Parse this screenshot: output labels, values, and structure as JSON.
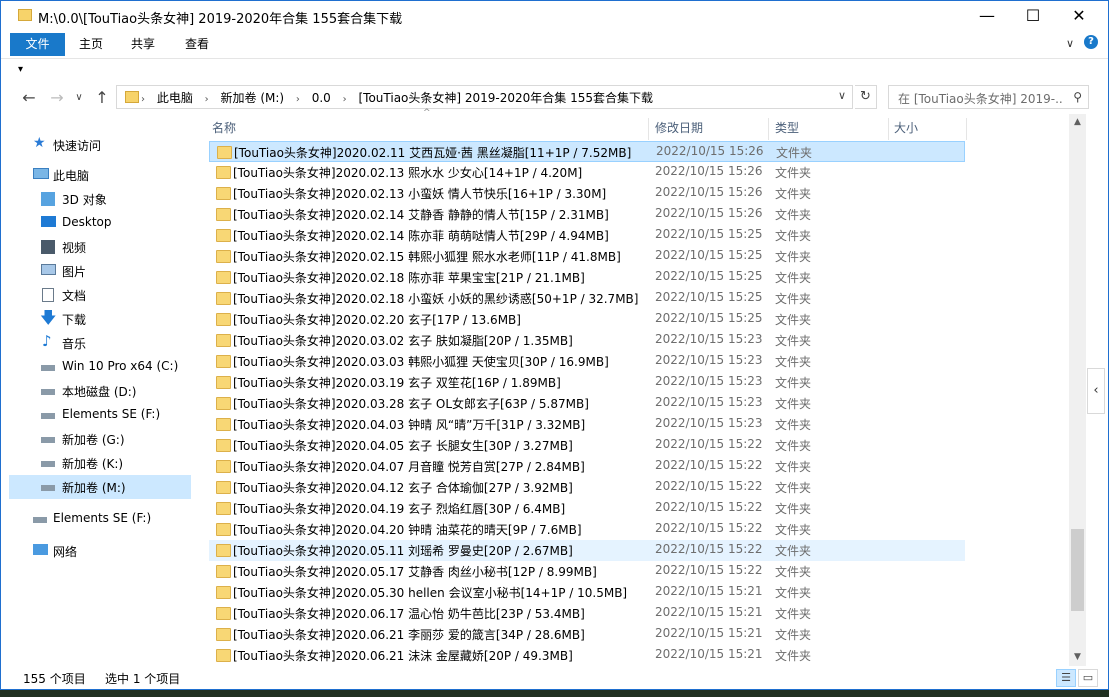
{
  "window": {
    "title": "M:\\0.0\\[TouTiao头条女神] 2019-2020年合集 155套合集下载",
    "minimize": "—",
    "maximize": "☐",
    "close": "✕"
  },
  "ribbon": {
    "tabs": [
      "文件",
      "主页",
      "共享",
      "查看"
    ],
    "expand": "∨",
    "help": "?"
  },
  "qat": {
    "arrow": "▾"
  },
  "nav": {
    "back": "←",
    "forward": "→",
    "recent": "∨",
    "up": "↑",
    "breadcrumb": [
      "此电脑",
      "新加卷 (M:)",
      "0.0",
      "[TouTiao头条女神] 2019-2020年合集 155套合集下载"
    ],
    "crumb_sep": "›",
    "address_dropdown": "∨",
    "refresh": "↻",
    "search_placeholder": "在 [TouTiao头条女神] 2019-...",
    "search_icon": "⚲"
  },
  "sidebar": {
    "items": [
      {
        "label": "快速访问",
        "icon": "star-icon"
      },
      {
        "label": "此电脑",
        "icon": "computer-icon"
      },
      {
        "label": "3D 对象",
        "icon": "cube-icon"
      },
      {
        "label": "Desktop",
        "icon": "desktop-icon"
      },
      {
        "label": "视频",
        "icon": "video-icon"
      },
      {
        "label": "图片",
        "icon": "picture-icon"
      },
      {
        "label": "文档",
        "icon": "document-icon"
      },
      {
        "label": "下载",
        "icon": "download-icon"
      },
      {
        "label": "音乐",
        "icon": "music-icon"
      },
      {
        "label": "Win 10 Pro x64 (C:)",
        "icon": "windows-drive-icon"
      },
      {
        "label": "本地磁盘 (D:)",
        "icon": "drive-icon"
      },
      {
        "label": "Elements SE (F:)",
        "icon": "drive-icon"
      },
      {
        "label": "新加卷 (G:)",
        "icon": "drive-icon"
      },
      {
        "label": "新加卷 (K:)",
        "icon": "drive-icon"
      },
      {
        "label": "新加卷 (M:)",
        "icon": "drive-icon"
      },
      {
        "label": "Elements SE (F:)",
        "icon": "drive-icon"
      },
      {
        "label": "网络",
        "icon": "network-icon"
      }
    ]
  },
  "columns": {
    "name": "名称",
    "date": "修改日期",
    "type": "类型",
    "size": "大小",
    "sort_indicator": "^"
  },
  "files": [
    {
      "name": "[TouTiao头条女神]2020.02.11 艾西瓦娅·茜 黑丝凝脂[11+1P / 7.52MB]",
      "date": "2022/10/15 15:26",
      "type": "文件夹"
    },
    {
      "name": "[TouTiao头条女神]2020.02.13 熙水水 少女心[14+1P / 4.20M]",
      "date": "2022/10/15 15:26",
      "type": "文件夹"
    },
    {
      "name": "[TouTiao头条女神]2020.02.13 小蛮妖 情人节快乐[16+1P / 3.30M]",
      "date": "2022/10/15 15:26",
      "type": "文件夹"
    },
    {
      "name": "[TouTiao头条女神]2020.02.14 艾静香 静静的情人节[15P / 2.31MB]",
      "date": "2022/10/15 15:26",
      "type": "文件夹"
    },
    {
      "name": "[TouTiao头条女神]2020.02.14 陈亦菲 萌萌哒情人节[29P / 4.94MB]",
      "date": "2022/10/15 15:25",
      "type": "文件夹"
    },
    {
      "name": "[TouTiao头条女神]2020.02.15 韩熙小狐狸 熙水水老师[11P / 41.8MB]",
      "date": "2022/10/15 15:25",
      "type": "文件夹"
    },
    {
      "name": "[TouTiao头条女神]2020.02.18 陈亦菲 苹果宝宝[21P / 21.1MB]",
      "date": "2022/10/15 15:25",
      "type": "文件夹"
    },
    {
      "name": "[TouTiao头条女神]2020.02.18 小蛮妖 小妖的黑纱诱惑[50+1P / 32.7MB]",
      "date": "2022/10/15 15:25",
      "type": "文件夹"
    },
    {
      "name": "[TouTiao头条女神]2020.02.20 玄子[17P / 13.6MB]",
      "date": "2022/10/15 15:25",
      "type": "文件夹"
    },
    {
      "name": "[TouTiao头条女神]2020.03.02 玄子 肤如凝脂[20P / 1.35MB]",
      "date": "2022/10/15 15:23",
      "type": "文件夹"
    },
    {
      "name": "[TouTiao头条女神]2020.03.03 韩熙小狐狸 天使宝贝[30P / 16.9MB]",
      "date": "2022/10/15 15:23",
      "type": "文件夹"
    },
    {
      "name": "[TouTiao头条女神]2020.03.19 玄子 双笙花[16P / 1.89MB]",
      "date": "2022/10/15 15:23",
      "type": "文件夹"
    },
    {
      "name": "[TouTiao头条女神]2020.03.28 玄子 OL女郎玄子[63P / 5.87MB]",
      "date": "2022/10/15 15:23",
      "type": "文件夹"
    },
    {
      "name": "[TouTiao头条女神]2020.04.03 钟晴 风“晴”万千[31P / 3.32MB]",
      "date": "2022/10/15 15:23",
      "type": "文件夹"
    },
    {
      "name": "[TouTiao头条女神]2020.04.05 玄子 长腿女生[30P / 3.27MB]",
      "date": "2022/10/15 15:22",
      "type": "文件夹"
    },
    {
      "name": "[TouTiao头条女神]2020.04.07 月音瞳 悦芳自赏[27P / 2.84MB]",
      "date": "2022/10/15 15:22",
      "type": "文件夹"
    },
    {
      "name": "[TouTiao头条女神]2020.04.12 玄子 合体瑜伽[27P / 3.92MB]",
      "date": "2022/10/15 15:22",
      "type": "文件夹"
    },
    {
      "name": "[TouTiao头条女神]2020.04.19 玄子 烈焰红唇[30P / 6.4MB]",
      "date": "2022/10/15 15:22",
      "type": "文件夹"
    },
    {
      "name": "[TouTiao头条女神]2020.04.20 钟晴 油菜花的晴天[9P / 7.6MB]",
      "date": "2022/10/15 15:22",
      "type": "文件夹"
    },
    {
      "name": "[TouTiao头条女神]2020.05.11 刘瑶希 罗曼史[20P / 2.67MB]",
      "date": "2022/10/15 15:22",
      "type": "文件夹"
    },
    {
      "name": "[TouTiao头条女神]2020.05.17 艾静香 肉丝小秘书[12P / 8.99MB]",
      "date": "2022/10/15 15:22",
      "type": "文件夹"
    },
    {
      "name": "[TouTiao头条女神]2020.05.30 hellen 会议室小秘书[14+1P / 10.5MB]",
      "date": "2022/10/15 15:21",
      "type": "文件夹"
    },
    {
      "name": "[TouTiao头条女神]2020.06.17 温心怡 奶牛芭比[23P / 53.4MB]",
      "date": "2022/10/15 15:21",
      "type": "文件夹"
    },
    {
      "name": "[TouTiao头条女神]2020.06.21 李丽莎 爱的箴言[34P / 28.6MB]",
      "date": "2022/10/15 15:21",
      "type": "文件夹"
    },
    {
      "name": "[TouTiao头条女神]2020.06.21 沫沫 金屋藏娇[20P / 49.3MB]",
      "date": "2022/10/15 15:21",
      "type": "文件夹"
    }
  ],
  "status": {
    "count": "155 个项目",
    "selected": "选中 1 个项目"
  },
  "scroll": {
    "up": "▲",
    "down": "▼",
    "panel_toggle": "‹"
  }
}
